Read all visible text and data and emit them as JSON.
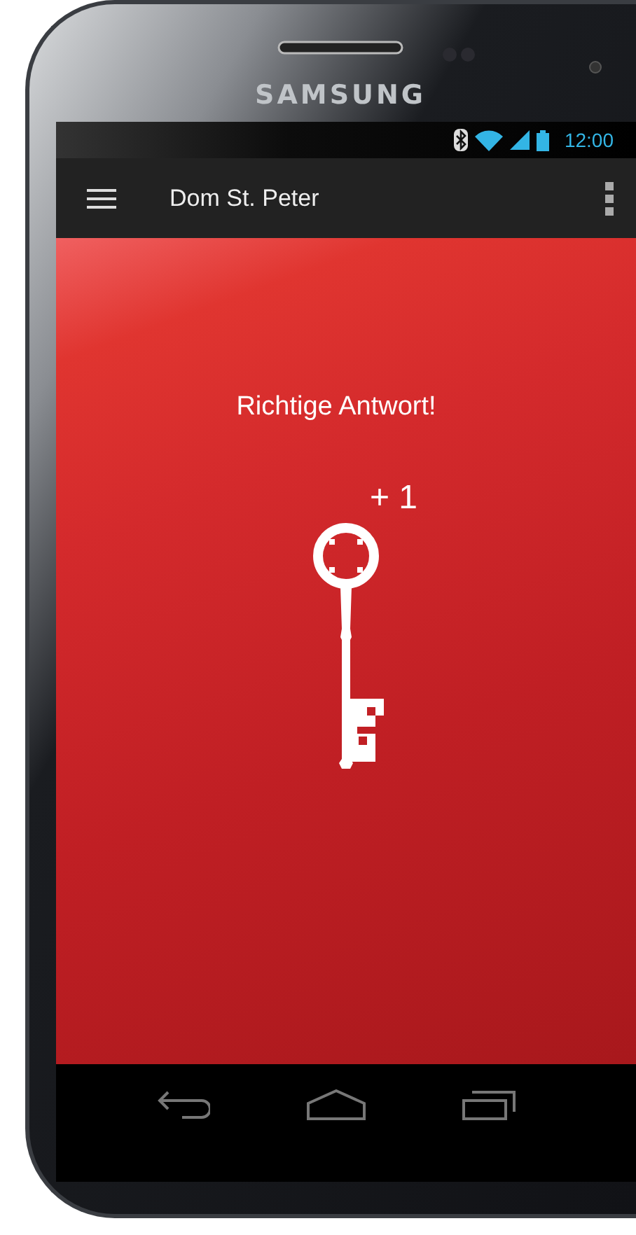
{
  "device": {
    "brand": "SAMSUNG"
  },
  "status_bar": {
    "time": "12:00"
  },
  "app_bar": {
    "title": "Dom St. Peter"
  },
  "content": {
    "message": "Richtige Antwort!",
    "points": "+ 1"
  }
}
